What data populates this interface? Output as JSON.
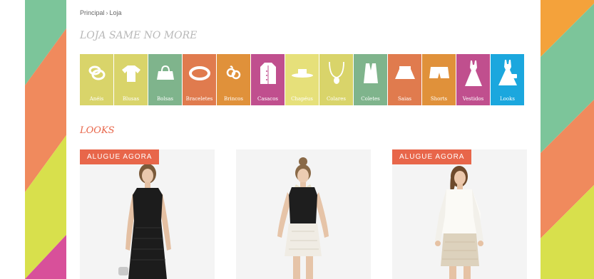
{
  "breadcrumb": {
    "home": "Principal",
    "separator": "›",
    "current": "Loja"
  },
  "shop": {
    "title": "LOJA SAME NO MORE"
  },
  "categories": [
    {
      "label": "Anéis",
      "icon": "ring-icon",
      "color": "#d9d46a"
    },
    {
      "label": "Blusas",
      "icon": "blouse-icon",
      "color": "#d9d46a"
    },
    {
      "label": "Bolsas",
      "icon": "bag-icon",
      "color": "#7fb48c"
    },
    {
      "label": "Braceletes",
      "icon": "bracelet-icon",
      "color": "#e07b4e"
    },
    {
      "label": "Brincos",
      "icon": "earrings-icon",
      "color": "#e0913a"
    },
    {
      "label": "Casacos",
      "icon": "coat-icon",
      "color": "#c04f8e"
    },
    {
      "label": "Chapéus",
      "icon": "hat-icon",
      "color": "#e6e07a"
    },
    {
      "label": "Colares",
      "icon": "necklace-icon",
      "color": "#d9d46a"
    },
    {
      "label": "Coletes",
      "icon": "vest-icon",
      "color": "#7fb48c"
    },
    {
      "label": "Saias",
      "icon": "skirt-icon",
      "color": "#e07b4e"
    },
    {
      "label": "Shorts",
      "icon": "shorts-icon",
      "color": "#e0913a"
    },
    {
      "label": "Vestidos",
      "icon": "dress-icon",
      "color": "#c04f8e"
    },
    {
      "label": "Looks",
      "icon": "look-dress-icon",
      "color": "#1ba7de"
    }
  ],
  "looks": {
    "title": "LOOKS",
    "items": [
      {
        "badge": "ALUGUE AGORA",
        "image": "look-black-dress-image"
      },
      {
        "badge": "",
        "image": "look-black-top-fur-skirt-image"
      },
      {
        "badge": "ALUGUE AGORA",
        "image": "look-white-shirt-skirt-image"
      }
    ]
  },
  "colors": {
    "accent": "#e8664a",
    "stripe_green": "#7cc59a",
    "stripe_orange": "#f08a5d",
    "stripe_yellow": "#d8e04c",
    "stripe_pink": "#d8509a",
    "stripe_amber": "#f4a23b"
  }
}
